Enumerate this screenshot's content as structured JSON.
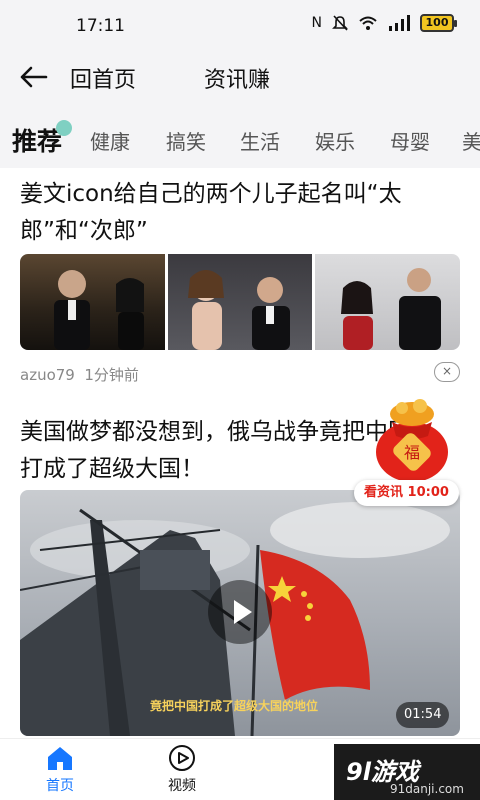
{
  "status_bar": {
    "time": "17:11",
    "battery": "100"
  },
  "header": {
    "home_label": "回首页",
    "earn_label": "资讯赚"
  },
  "tabs": [
    {
      "label": "推荐"
    },
    {
      "label": "健康"
    },
    {
      "label": "搞笑"
    },
    {
      "label": "生活"
    },
    {
      "label": "娱乐"
    },
    {
      "label": "母婴"
    },
    {
      "label": "美"
    }
  ],
  "feed": [
    {
      "title": "姜文icon给自己的两个儿子起名叫“太郎”和“次郎”",
      "author": "azuo79",
      "time_ago": "1分钟前",
      "close_symbol": "×"
    },
    {
      "title": "美国做梦都没想到，俄乌战争竟把中国打成了超级大国！",
      "subtitle": "竟把中国打成了超级大国的地位",
      "duration": "01:54"
    }
  ],
  "reward": {
    "bag_text": "福",
    "label": "看资讯 10:00"
  },
  "bottom_nav": [
    {
      "label": "首页"
    },
    {
      "label": "视频"
    }
  ],
  "watermark": {
    "main": "9l游戏",
    "sub": "91danji.com"
  },
  "colors": {
    "accent": "#1677ff",
    "reward_red": "#e2231a",
    "tab_dot": "#7fd0c2"
  }
}
